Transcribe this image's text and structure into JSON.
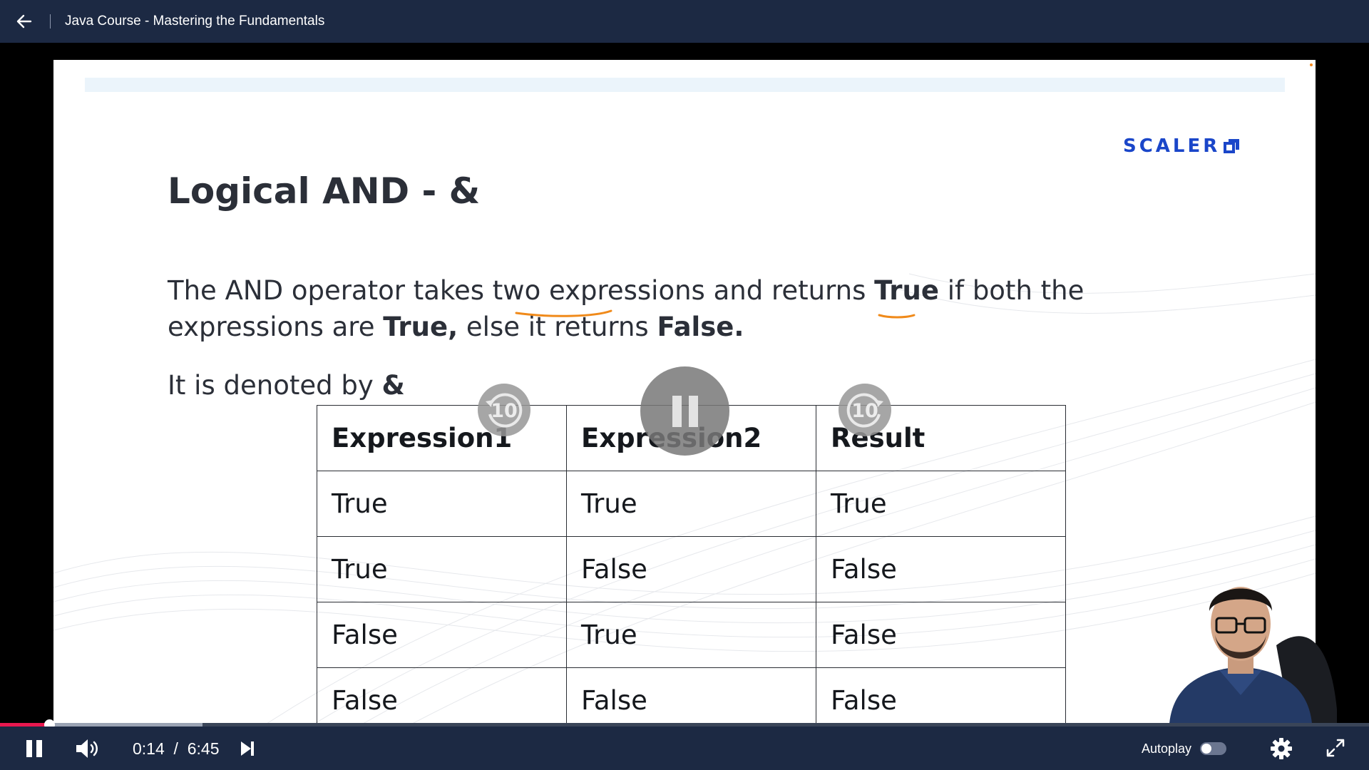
{
  "header": {
    "course_title": "Java Course - Mastering the Fundamentals",
    "back_icon": "arrow-left-icon"
  },
  "slide": {
    "brand": "SCALER",
    "title": "Logical AND - &",
    "para_parts": [
      "The AND operator takes two expressions and returns ",
      "True",
      " if both the expressions are ",
      "True,",
      " else it returns ",
      "False."
    ],
    "denoted_prefix": "It is denoted by ",
    "denoted_symbol": "&",
    "table": {
      "headers": [
        "Expression1",
        "Expression2",
        "Result"
      ],
      "rows": [
        [
          "True",
          "True",
          "True"
        ],
        [
          "True",
          "False",
          "False"
        ],
        [
          "False",
          "True",
          "False"
        ],
        [
          "False",
          "False",
          "False"
        ]
      ]
    }
  },
  "overlay": {
    "rewind_seconds": "10",
    "forward_seconds": "10"
  },
  "player": {
    "current_time": "0:14",
    "time_separator": "/",
    "duration": "6:45",
    "progress_fraction": 0.036,
    "buffered_fraction": 0.148,
    "autoplay_label": "Autoplay",
    "autoplay_on": false
  },
  "colors": {
    "bar_bg": "#1c2943",
    "progress_played": "#e8184f",
    "brand_blue": "#1a46c9",
    "annotation_orange": "#f08a1a"
  }
}
